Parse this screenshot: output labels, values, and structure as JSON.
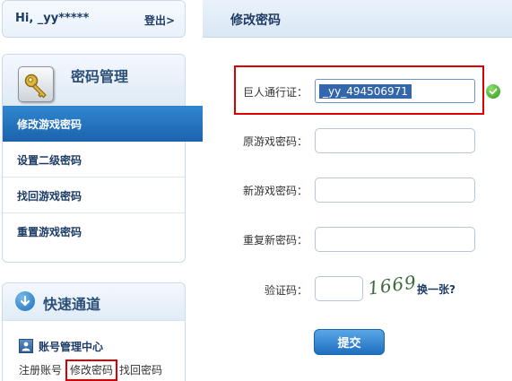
{
  "user": {
    "greeting": "Hi, _yy*****",
    "logout_label": "登出>"
  },
  "sidebar": {
    "panel_title": "密码管理",
    "panel_icon": "key-icon",
    "items": [
      {
        "label": "修改游戏密码",
        "active": true
      },
      {
        "label": "设置二级密码",
        "active": false
      },
      {
        "label": "找回游戏密码",
        "active": false
      },
      {
        "label": "重置游戏密码",
        "active": false
      }
    ]
  },
  "quick_access": {
    "title": "快速通道",
    "title_icon": "down-arrow-icon",
    "section_title": "账号管理中心",
    "section_icon": "account-icon",
    "links": [
      "注册账号",
      "修改密码",
      "找回密码"
    ]
  },
  "main": {
    "title": "修改密码",
    "form": {
      "passport_label": "巨人通行证：",
      "passport_value": "_yy_494506971",
      "old_password_label": "原游戏密码：",
      "new_password_label": "新游戏密码：",
      "confirm_password_label": "重复新密码：",
      "captcha_label": "验证码：",
      "captcha_image_text": "1669",
      "captcha_refresh_label": "换一张?",
      "submit_label": "提交"
    }
  },
  "colors": {
    "accent": "#1c63ad",
    "highlight": "#dd0000",
    "valid": "#2f9a1b"
  }
}
